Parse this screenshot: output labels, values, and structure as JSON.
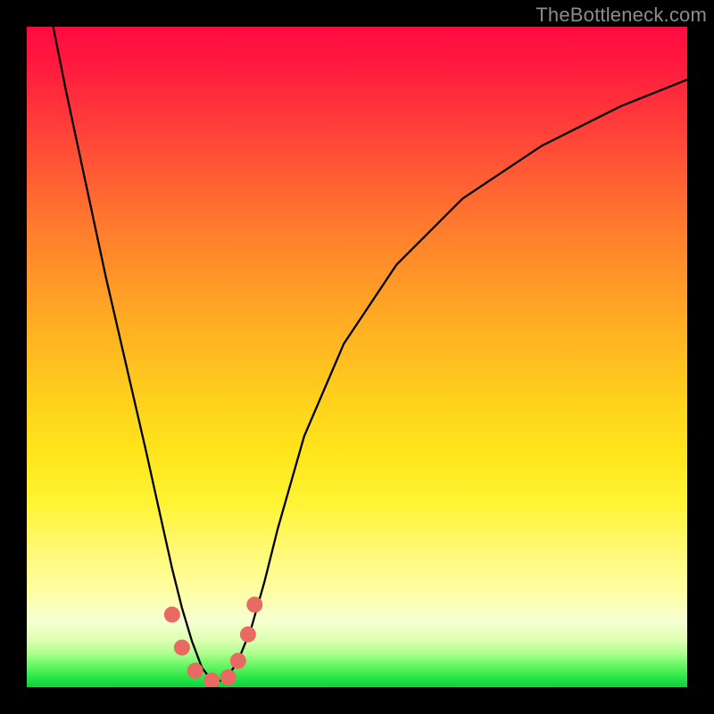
{
  "watermark": "TheBottleneck.com",
  "colors": {
    "background": "#000000",
    "curve": "#000000",
    "markers": "#e86a63",
    "gradient_top": "#ff0a41",
    "gradient_bottom": "#0fd13a"
  },
  "chart_data": {
    "type": "line",
    "title": "",
    "xlabel": "",
    "ylabel": "",
    "xlim": [
      0,
      100
    ],
    "ylim": [
      0,
      100
    ],
    "grid": false,
    "legend": false,
    "series": [
      {
        "name": "bottleneck-curve",
        "x": [
          0,
          3,
          6,
          9,
          12,
          15,
          18,
          20,
          22,
          23.5,
          25,
          26.5,
          28,
          30,
          32,
          34,
          36,
          38,
          42,
          48,
          56,
          66,
          78,
          90,
          100
        ],
        "y": [
          120,
          105,
          90,
          76,
          62,
          49,
          36,
          27,
          18,
          12,
          7,
          3,
          1,
          1,
          4,
          9,
          16,
          24,
          38,
          52,
          64,
          74,
          82,
          88,
          92
        ]
      }
    ],
    "annotations": [
      {
        "name": "marker",
        "x": 22.0,
        "y": 11.0
      },
      {
        "name": "marker",
        "x": 23.5,
        "y": 6.0
      },
      {
        "name": "marker",
        "x": 25.5,
        "y": 2.5
      },
      {
        "name": "marker",
        "x": 28.0,
        "y": 1.0
      },
      {
        "name": "marker",
        "x": 30.5,
        "y": 1.5
      },
      {
        "name": "marker",
        "x": 32.0,
        "y": 4.0
      },
      {
        "name": "marker",
        "x": 33.5,
        "y": 8.0
      },
      {
        "name": "marker",
        "x": 34.5,
        "y": 12.5
      }
    ]
  }
}
